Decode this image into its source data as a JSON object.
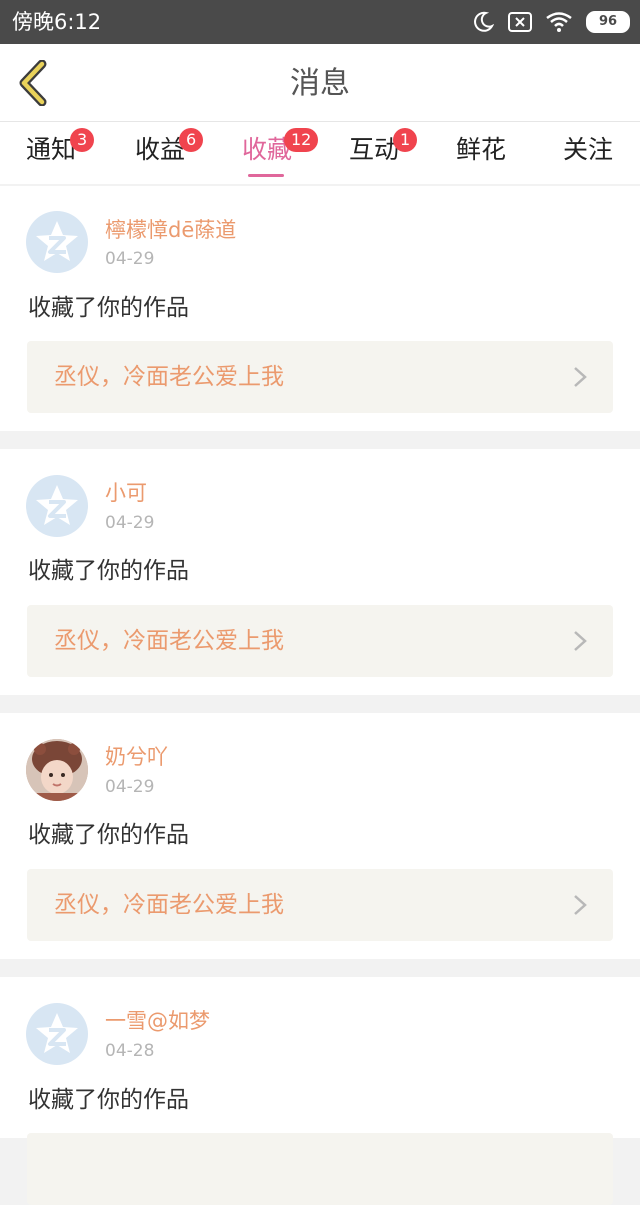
{
  "status_bar": {
    "time": "傍晚6:12",
    "battery": "96",
    "icons": [
      "moon-icon",
      "sim-error-icon",
      "wifi-icon",
      "battery-icon"
    ]
  },
  "header": {
    "title": "消息",
    "back_icon": "chevron-left-icon"
  },
  "tabs": [
    {
      "label": "通知",
      "badge": "3"
    },
    {
      "label": "收益",
      "badge": "6"
    },
    {
      "label": "收藏",
      "badge": "12",
      "active": true
    },
    {
      "label": "互动",
      "badge": "1"
    },
    {
      "label": "鲜花",
      "badge": ""
    },
    {
      "label": "关注",
      "badge": ""
    }
  ],
  "colors": {
    "accent": "#e0679b",
    "name": "#eb9a6e",
    "badge": "#f0444e",
    "status_bar": "#4a4a4a",
    "work_box": "#f5f4ef"
  },
  "messages": [
    {
      "name": "檸檬慞dē蒢道",
      "date": "04-29",
      "text": "收藏了你的作品",
      "work": "丞仪，冷面老公爱上我",
      "avatar": "default-avatar-icon"
    },
    {
      "name": "小可",
      "date": "04-29",
      "text": "收藏了你的作品",
      "work": "丞仪，冷面老公爱上我",
      "avatar": "default-avatar-icon"
    },
    {
      "name": "奶兮吖",
      "date": "04-29",
      "text": "收藏了你的作品",
      "work": "丞仪，冷面老公爱上我",
      "avatar": "user-photo"
    },
    {
      "name": "一雪@如梦",
      "date": "04-28",
      "text": "收藏了你的作品",
      "work": "",
      "avatar": "default-avatar-icon"
    }
  ]
}
